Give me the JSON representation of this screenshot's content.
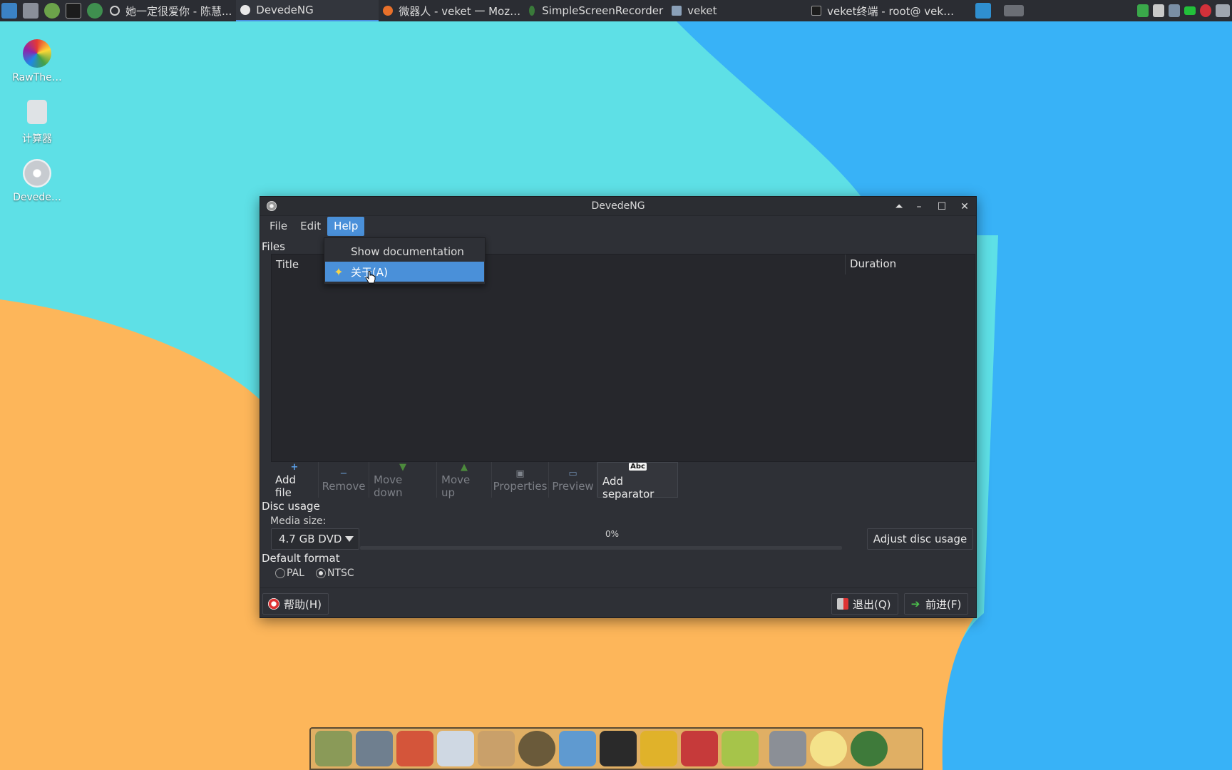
{
  "taskbar": {
    "tasks": [
      {
        "label": "她一定很爱你 - 陈慧...",
        "icon": "circle-icon",
        "active": false
      },
      {
        "label": "DevedeNG",
        "icon": "disc-icon",
        "active": true
      },
      {
        "label": "微器人 - veket 一 Moz…",
        "icon": "firefox-icon",
        "active": false
      },
      {
        "label": "SimpleScreenRecorder",
        "icon": "recorder-icon",
        "active": false
      },
      {
        "label": "veket",
        "icon": "folder-icon",
        "active": false
      },
      {
        "label": "veket终端 - root@ vek…",
        "icon": "terminal-icon",
        "active": false
      }
    ]
  },
  "desktop": {
    "icons": [
      {
        "label": "RawThe…",
        "icon": "rawtherapee-icon"
      },
      {
        "label": "计算器",
        "icon": "calculator-icon"
      },
      {
        "label": "Devede…",
        "icon": "devede-disc-icon"
      }
    ]
  },
  "window": {
    "title": "DevedeNG",
    "menus": [
      "File",
      "Edit",
      "Help"
    ],
    "open_menu": "Help",
    "dropdown": {
      "items": [
        {
          "label": "Show documentation",
          "icon": ""
        },
        {
          "label": "关于(A)",
          "icon": "about-star-icon",
          "hovered": true
        }
      ]
    },
    "files_section_label": "Files",
    "columns": {
      "title": "Title",
      "duration": "Duration"
    },
    "toolbar": [
      {
        "label": "Add file",
        "icon": "plus-icon",
        "enabled": true
      },
      {
        "label": "Remove",
        "icon": "minus-icon",
        "enabled": false
      },
      {
        "label": "Move down",
        "icon": "arrow-down-icon",
        "enabled": false
      },
      {
        "label": "Move up",
        "icon": "arrow-up-icon",
        "enabled": false
      },
      {
        "label": "Properties",
        "icon": "properties-icon",
        "enabled": false
      },
      {
        "label": "Preview",
        "icon": "preview-icon",
        "enabled": false
      },
      {
        "label": "Add separator",
        "icon": "abc-separator-icon",
        "icon_text": "Abc",
        "enabled": true
      }
    ],
    "disc_usage": {
      "label": "Disc usage",
      "media_size_label": "Media size:",
      "media_size_value": "4.7 GB DVD",
      "progress_text": "0%",
      "progress_fraction": 0,
      "adjust_label": "Adjust disc usage"
    },
    "default_format": {
      "label": "Default format",
      "options": [
        {
          "label": "PAL",
          "checked": false
        },
        {
          "label": "NTSC",
          "checked": true
        }
      ]
    },
    "buttons": {
      "help": "帮助(H)",
      "quit": "退出(Q)",
      "forward": "前进(F)"
    }
  },
  "colors": {
    "wallpaper_cyan": "#5ee0e6",
    "wallpaper_blue": "#38b2f7",
    "wallpaper_orange": "#fdb65a",
    "accent": "#4a90d9"
  }
}
